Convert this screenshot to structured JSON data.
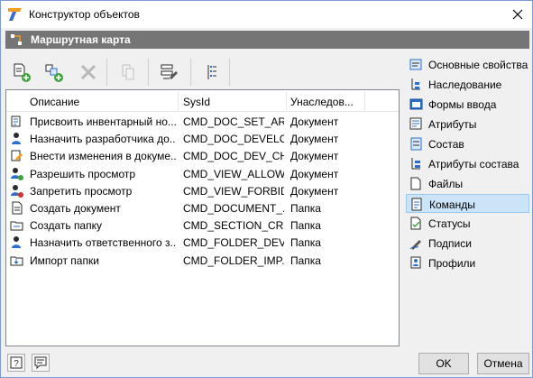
{
  "window": {
    "title": "Конструктор объектов",
    "accent": "#0078d7",
    "header_band_color": "#757575"
  },
  "header": {
    "title": "Маршрутная карта"
  },
  "toolbar": {
    "buttons": [
      {
        "icon": "add-object-icon"
      },
      {
        "icon": "add-linked-icon"
      },
      {
        "icon": "delete-icon",
        "disabled": true
      },
      {
        "icon": "copy-icon",
        "disabled": true
      },
      {
        "icon": "edit-properties-icon"
      },
      {
        "icon": "list-icon"
      }
    ]
  },
  "grid": {
    "columns": [
      "Описание",
      "SysId",
      "Унаследов..."
    ],
    "rows": [
      {
        "icon": "assign-number-icon",
        "description": "Присвоить инвентарный но...",
        "sysid": "CMD_DOC_SET_AR...",
        "inherited": "Документ"
      },
      {
        "icon": "assign-user-icon",
        "description": "Назначить разработчика до...",
        "sysid": "CMD_DOC_DEVELO...",
        "inherited": "Документ"
      },
      {
        "icon": "edit-doc-icon",
        "description": "Внести изменения в докуме...",
        "sysid": "CMD_DOC_DEV_CH...",
        "inherited": "Документ"
      },
      {
        "icon": "allow-view-icon",
        "description": "Разрешить просмотр",
        "sysid": "CMD_VIEW_ALLOW",
        "inherited": "Документ"
      },
      {
        "icon": "forbid-view-icon",
        "description": "Запретить просмотр",
        "sysid": "CMD_VIEW_FORBID",
        "inherited": "Документ"
      },
      {
        "icon": "new-document-icon",
        "description": "Создать документ",
        "sysid": "CMD_DOCUMENT_...",
        "inherited": "Папка"
      },
      {
        "icon": "new-folder-icon",
        "description": "Создать папку",
        "sysid": "CMD_SECTION_CRE...",
        "inherited": "Папка"
      },
      {
        "icon": "assign-responsible-icon",
        "description": "Назначить ответственного з...",
        "sysid": "CMD_FOLDER_DEV...",
        "inherited": "Папка"
      },
      {
        "icon": "import-folder-icon",
        "description": "Импорт папки",
        "sysid": "CMD_FOLDER_IMP...",
        "inherited": "Папка"
      }
    ]
  },
  "sidebar": {
    "items": [
      {
        "label": "Основные свойства",
        "icon": "properties-icon",
        "active": false
      },
      {
        "label": "Наследование",
        "icon": "inheritance-icon",
        "active": false
      },
      {
        "label": "Формы ввода",
        "icon": "forms-icon",
        "active": false
      },
      {
        "label": "Атрибуты",
        "icon": "attributes-icon",
        "active": false
      },
      {
        "label": "Состав",
        "icon": "composition-icon",
        "active": false
      },
      {
        "label": "Атрибуты состава",
        "icon": "composition-attributes-icon",
        "active": false
      },
      {
        "label": "Файлы",
        "icon": "files-icon",
        "active": false
      },
      {
        "label": "Команды",
        "icon": "commands-icon",
        "active": true
      },
      {
        "label": "Статусы",
        "icon": "statuses-icon",
        "active": false
      },
      {
        "label": "Подписи",
        "icon": "signatures-icon",
        "active": false
      },
      {
        "label": "Профили",
        "icon": "profiles-icon",
        "active": false
      }
    ]
  },
  "footer": {
    "help_icon": "help-icon",
    "comment_icon": "comment-icon",
    "ok_label": "OK",
    "cancel_label": "Отмена"
  }
}
